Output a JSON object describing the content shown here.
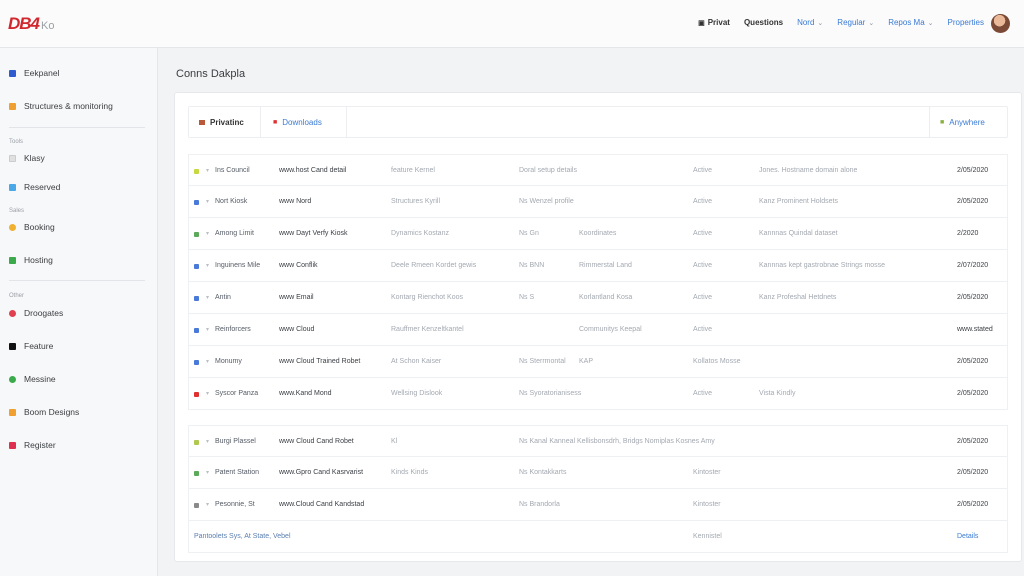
{
  "header": {
    "logo_brand": "DB4",
    "logo_sub": "Ko",
    "nav": [
      {
        "label": "Privat",
        "style": "dark"
      },
      {
        "label": "Questions",
        "style": "dark"
      },
      {
        "label": "Nord",
        "style": "link"
      },
      {
        "label": "Regular",
        "style": "link"
      },
      {
        "label": "Repos Ma",
        "style": "link"
      },
      {
        "label": "Properties",
        "style": "link"
      }
    ]
  },
  "sidebar": {
    "items": [
      {
        "label": "Eekpanel",
        "color": "#2f5bd0"
      },
      {
        "label": "Structures & monitoring",
        "color": "#f0a030"
      },
      {
        "label": "Klasy",
        "color": "#e0e0e0"
      },
      {
        "label": "Reserved",
        "color": "#4aa8e8"
      },
      {
        "label": "Booking",
        "color": "#f0b030"
      },
      {
        "label": "Hosting",
        "color": "#3aaa4a"
      },
      {
        "label": "Droogates",
        "color": "#e04050"
      },
      {
        "label": "Feature",
        "color": "#111111"
      },
      {
        "label": "Messine",
        "color": "#3aaa4a"
      },
      {
        "label": "Boom Designs",
        "color": "#f0a030"
      },
      {
        "label": "Register",
        "color": "#e03050"
      }
    ],
    "sections": [
      "Tools",
      "Sales",
      "Other"
    ]
  },
  "main": {
    "title": "Conns Dakpla",
    "tabs": {
      "active": "Privatinc",
      "second": "Downloads",
      "right": "Anywhere"
    },
    "rows": [
      {
        "sq": "#c8d840",
        "name": "Ins Council",
        "owner": "www.host Cand detail",
        "c3": "feature Kernel",
        "c4": "Doral setup details",
        "c5": "",
        "c6": "Active",
        "c7": "Jones. Hostname domain alone",
        "date": "2/05/2020"
      },
      {
        "sq": "#4a7ad8",
        "name": "Nort Kiosk",
        "owner": "www Nord",
        "c3": "Structures Kyrill",
        "c4": "Ns Wenzel profile",
        "c5": "",
        "c6": "Active",
        "c7": "Kanz Prominent Holdsets",
        "date": "2/05/2020"
      },
      {
        "sq": "#5aaa5a",
        "name": "Among Limit",
        "owner": "www Dayt Verfy Kiosk",
        "c3": "Dynamics Kostanz",
        "c4": "Ns Gn",
        "c5": "Koordinates",
        "c6": "Active",
        "c7": "Kannnas Quindal dataset",
        "date": "2/2020"
      },
      {
        "sq": "#4a7ad8",
        "name": "Inguinens Mile",
        "owner": "www Conflik",
        "c3": "Deele Rmeen Kordet gewis",
        "c4": "Ns BNN",
        "c5": "Rimmerstal Land",
        "c6": "Active",
        "c7": "Kannnas kept gastrobnae Strings mosse",
        "date": "2/07/2020"
      },
      {
        "sq": "#4a7ad8",
        "name": "Antin",
        "owner": "www Email",
        "c3": "Kontarg Rienchot Koos",
        "c4": "Ns S",
        "c5": "Korlantland Kosa",
        "c6": "Active",
        "c7": "Kanz Profeshal Hetdnets",
        "date": "2/05/2020"
      },
      {
        "sq": "#4a7ad8",
        "name": "Reinforcers",
        "owner": "www Cloud",
        "c3": "Rauffmer Kenzeltkantel",
        "c4": "",
        "c5": "Communitys Keepal",
        "c6": "Active",
        "c7": "",
        "date": "www.stated"
      },
      {
        "sq": "#4a7ad8",
        "name": "Monumy",
        "owner": "www Cloud Trained Robet",
        "c3": "At Schon Kaiser",
        "c4": "Ns Sterrmontal",
        "c5": "KAP",
        "c6": "Kollatos Mosse",
        "c7": "",
        "date": "2/05/2020"
      },
      {
        "sq": "#e03030",
        "name": "Syscor Panza",
        "owner": "www.Kand Mond",
        "c3": "Wellsing Dislook",
        "c4": "Ns Syoratorianisess",
        "c5": "",
        "c6": "Active",
        "c7": "Vista Kindly",
        "date": "2/05/2020"
      },
      {
        "sq": "#b0c850",
        "name": "Burgi Plassel",
        "owner": "www Cloud Cand Robet",
        "c3": "Kl",
        "c4": "Ns Kanal Kanneal Kellisbonsdrh, Bridgs Nomiplas Kosnes Amy",
        "c5": "",
        "c6": "",
        "c7": "",
        "date": "2/05/2020"
      },
      {
        "sq": "#5aaa5a",
        "name": "Patent Station",
        "owner": "www.Gpro Cand Kasrvarist",
        "c3": "Kinds Kinds",
        "c4": "Ns Kontakkarts",
        "c5": "",
        "c6": "Kintoster",
        "c7": "",
        "date": "2/05/2020"
      },
      {
        "sq": "#8a8a8a",
        "name": "Pesonnie, St",
        "owner": "www.Cloud Cand Kandstad",
        "c3": "",
        "c4": "Ns Brandorla",
        "c5": "",
        "c6": "Kintoster",
        "c7": "",
        "date": "2/05/2020"
      }
    ],
    "footer": {
      "left": "Pantoolets Sys, At State, Vebel",
      "mid": "Kennistel",
      "right": "Details"
    }
  }
}
